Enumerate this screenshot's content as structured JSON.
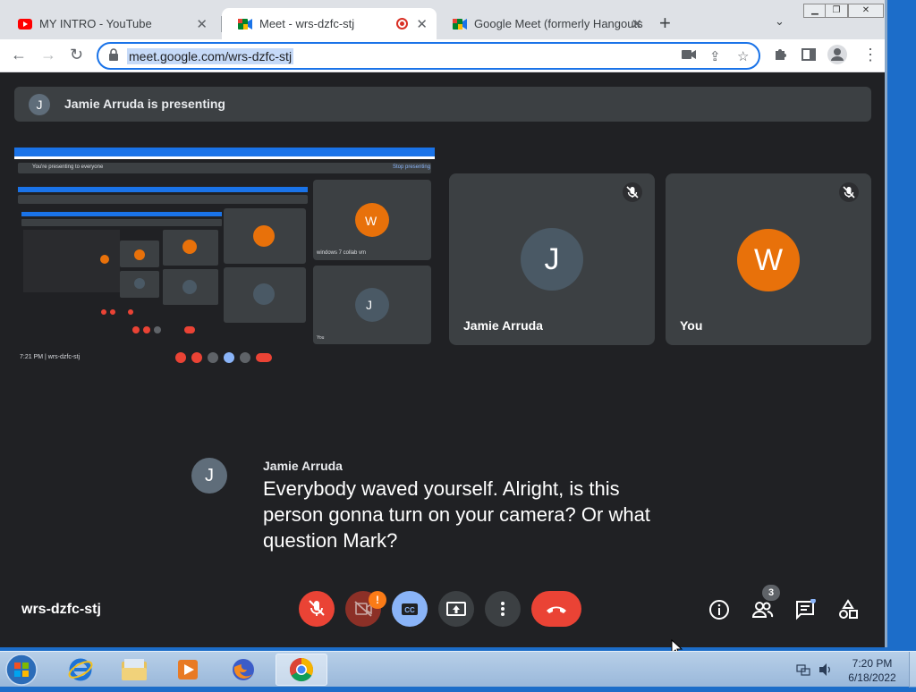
{
  "browser": {
    "tabs": [
      {
        "title": "MY INTRO - YouTube",
        "icon": "youtube-icon"
      },
      {
        "title": "Meet - wrs-dzfc-stj",
        "icon": "meet-icon",
        "active": true
      },
      {
        "title": "Google Meet (formerly Hangouts",
        "icon": "meet-icon"
      }
    ],
    "url": "meet.google.com/wrs-dzfc-stj"
  },
  "meet": {
    "presenting_banner": "Jamie Arruda is presenting",
    "presenter_initial": "J",
    "participants": [
      {
        "name": "Jamie Arruda",
        "initial": "J",
        "color": "#4a5965",
        "muted": true
      },
      {
        "name": "You",
        "initial": "W",
        "color": "#e8710a",
        "muted": true
      }
    ],
    "caption": {
      "speaker": "Jamie Arruda",
      "initial": "J",
      "text": "Everybody waved yourself. Alright, is this person gonna turn on your camera? Or what question Mark?"
    },
    "meeting_code": "wrs-dzfc-stj",
    "people_count": "3",
    "camera_alert": "!"
  },
  "shared_screen": {
    "banner": "You're presenting to everyone",
    "stop_label": "Stop presenting",
    "time_code": "7:21 PM  |  wrs-dzfc-stj",
    "tiles": [
      {
        "initial": "W",
        "color": "#e8710a",
        "label": "windows 7 collab vm"
      },
      {
        "initial": "J",
        "color": "#4a5965",
        "label": "You"
      }
    ]
  },
  "taskbar": {
    "time": "7:20 PM",
    "date": "6/18/2022"
  },
  "colors": {
    "red": "#ea4335",
    "blue_cc": "#8ab4f8",
    "dark_btn": "#3c4043"
  }
}
